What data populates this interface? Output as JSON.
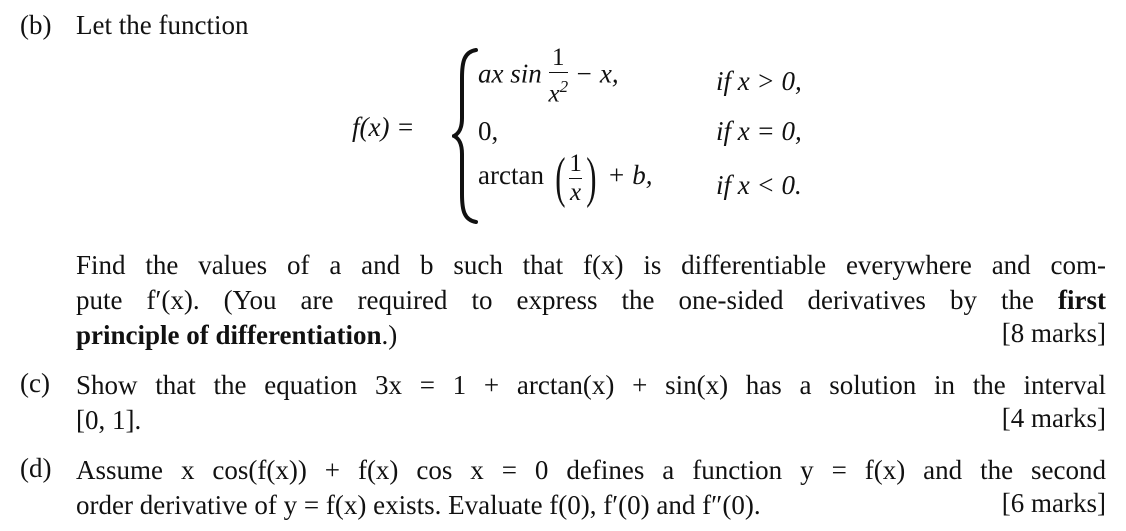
{
  "part_b": {
    "label": "(b)",
    "intro": "Let the function",
    "function_name": "f(x) =",
    "cases": [
      {
        "expr_prefix": "ax sin",
        "frac_num": "1",
        "frac_den": "x",
        "frac_den_exp": "2",
        "expr_suffix": "− x,",
        "condition": "if x > 0,"
      },
      {
        "expr": "0,",
        "condition": "if x = 0,"
      },
      {
        "expr_prefix": "arctan",
        "frac_num": "1",
        "frac_den": "x",
        "expr_suffix": "+ b,",
        "condition": "if x < 0."
      }
    ],
    "question_line1": "Find the values of a and b such that f(x) is differentiable everywhere and com-",
    "question_line2_normal": "pute f′(x). (You are required to express the one-sided derivatives by the",
    "question_line2_bold": "first",
    "question_line3_bold": "principle of differentiation",
    "question_line3_tail": ".)",
    "marks": "[8 marks]"
  },
  "part_c": {
    "label": "(c)",
    "line1": "Show that the equation 3x = 1 + arctan(x) + sin(x) has a solution in the interval",
    "line2": "[0, 1].",
    "marks": "[4 marks]"
  },
  "part_d": {
    "label": "(d)",
    "line1": "Assume x cos(f(x)) + f(x) cos x = 0 defines a function y = f(x) and the second",
    "line2": "order derivative of y = f(x) exists. Evaluate f(0), f′(0) and f″(0).",
    "marks": "[6 marks]"
  }
}
